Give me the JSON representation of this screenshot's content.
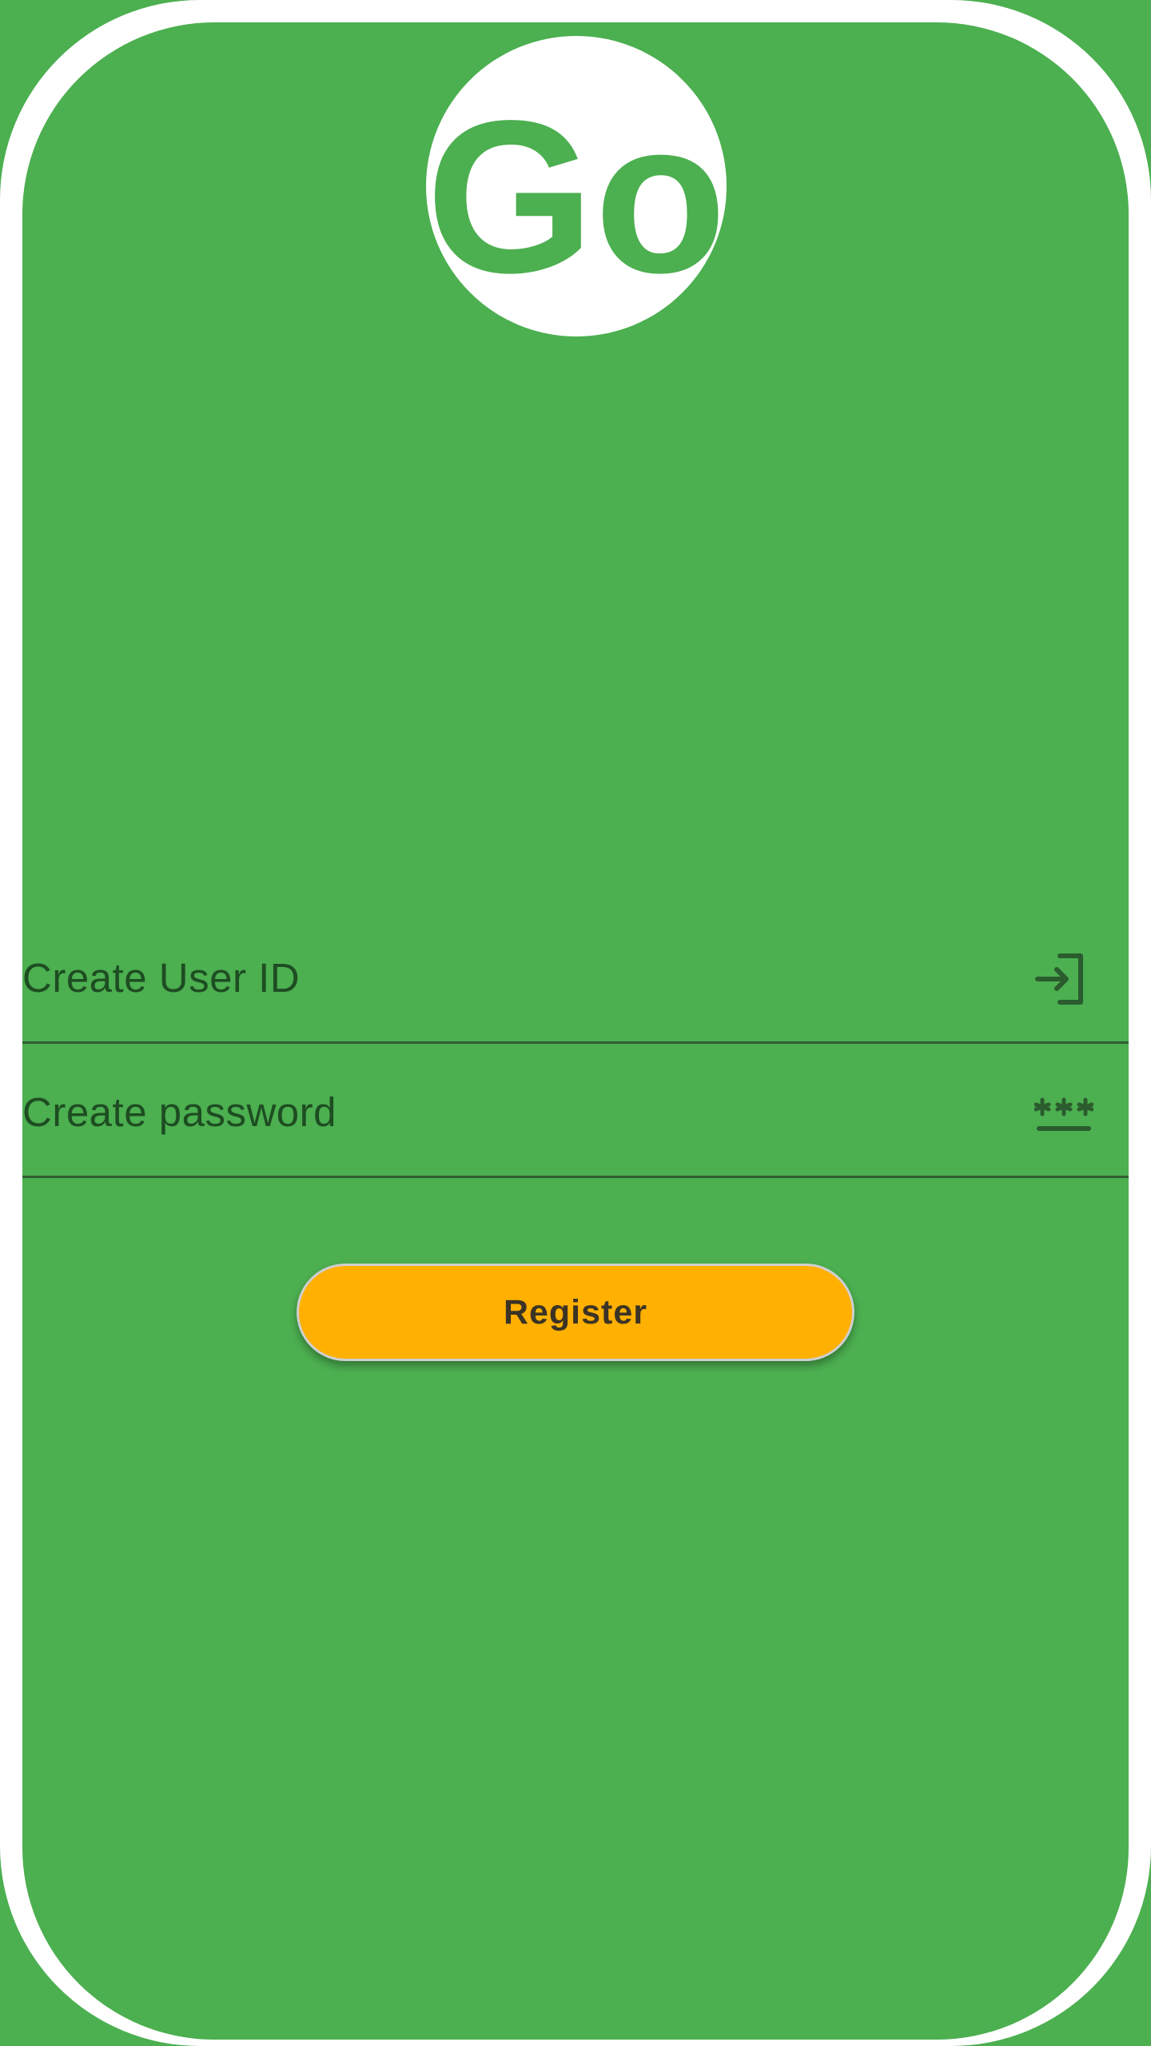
{
  "logo": {
    "text": "Go",
    "text_color": "#4caf50",
    "background": "#ffffff"
  },
  "form": {
    "user_id": {
      "placeholder": "Create User ID",
      "icon": "login-icon"
    },
    "password": {
      "placeholder": "Create password",
      "icon": "password-icon"
    }
  },
  "register": {
    "label": "Register",
    "color": "#ffb000"
  },
  "colors": {
    "background": "#4caf50",
    "frame": "#ffffff",
    "text": "#1e4d22",
    "divider": "#2f5e33"
  }
}
